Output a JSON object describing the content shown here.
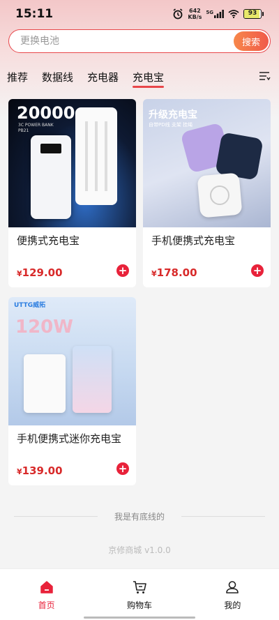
{
  "status": {
    "time": "15:11",
    "net_speed_value": "642",
    "net_speed_unit": "KB/s",
    "signal_label": "5G",
    "battery": "93"
  },
  "search": {
    "placeholder": "更换电池",
    "button_label": "搜索"
  },
  "tabs": [
    {
      "label": "推荐"
    },
    {
      "label": "数据线"
    },
    {
      "label": "充电器"
    },
    {
      "label": "充电宝",
      "active": true
    }
  ],
  "products": [
    {
      "title": "便携式充电宝",
      "price": "129.00",
      "currency": "¥",
      "image_text": "20000",
      "image_sub": "3C POWER BANK",
      "image_model": "PB21"
    },
    {
      "title": "手机便携式充电宝",
      "price": "178.00",
      "currency": "¥",
      "image_text": "升级充电宝",
      "image_sub": "自带PD线 支架 挂绳"
    },
    {
      "title": "手机便携式迷你充电宝",
      "price": "139.00",
      "currency": "¥",
      "image_text": "120W",
      "image_brand": "UTTG威拓"
    }
  ],
  "footer": {
    "end_text": "我是有底线的",
    "version": "京修商城 v1.0.0"
  },
  "nav": [
    {
      "label": "首页",
      "icon": "home-icon",
      "active": true
    },
    {
      "label": "购物车",
      "icon": "cart-icon"
    },
    {
      "label": "我的",
      "icon": "user-icon"
    }
  ],
  "colors": {
    "accent": "#e8223a",
    "price": "#d82a2a"
  }
}
